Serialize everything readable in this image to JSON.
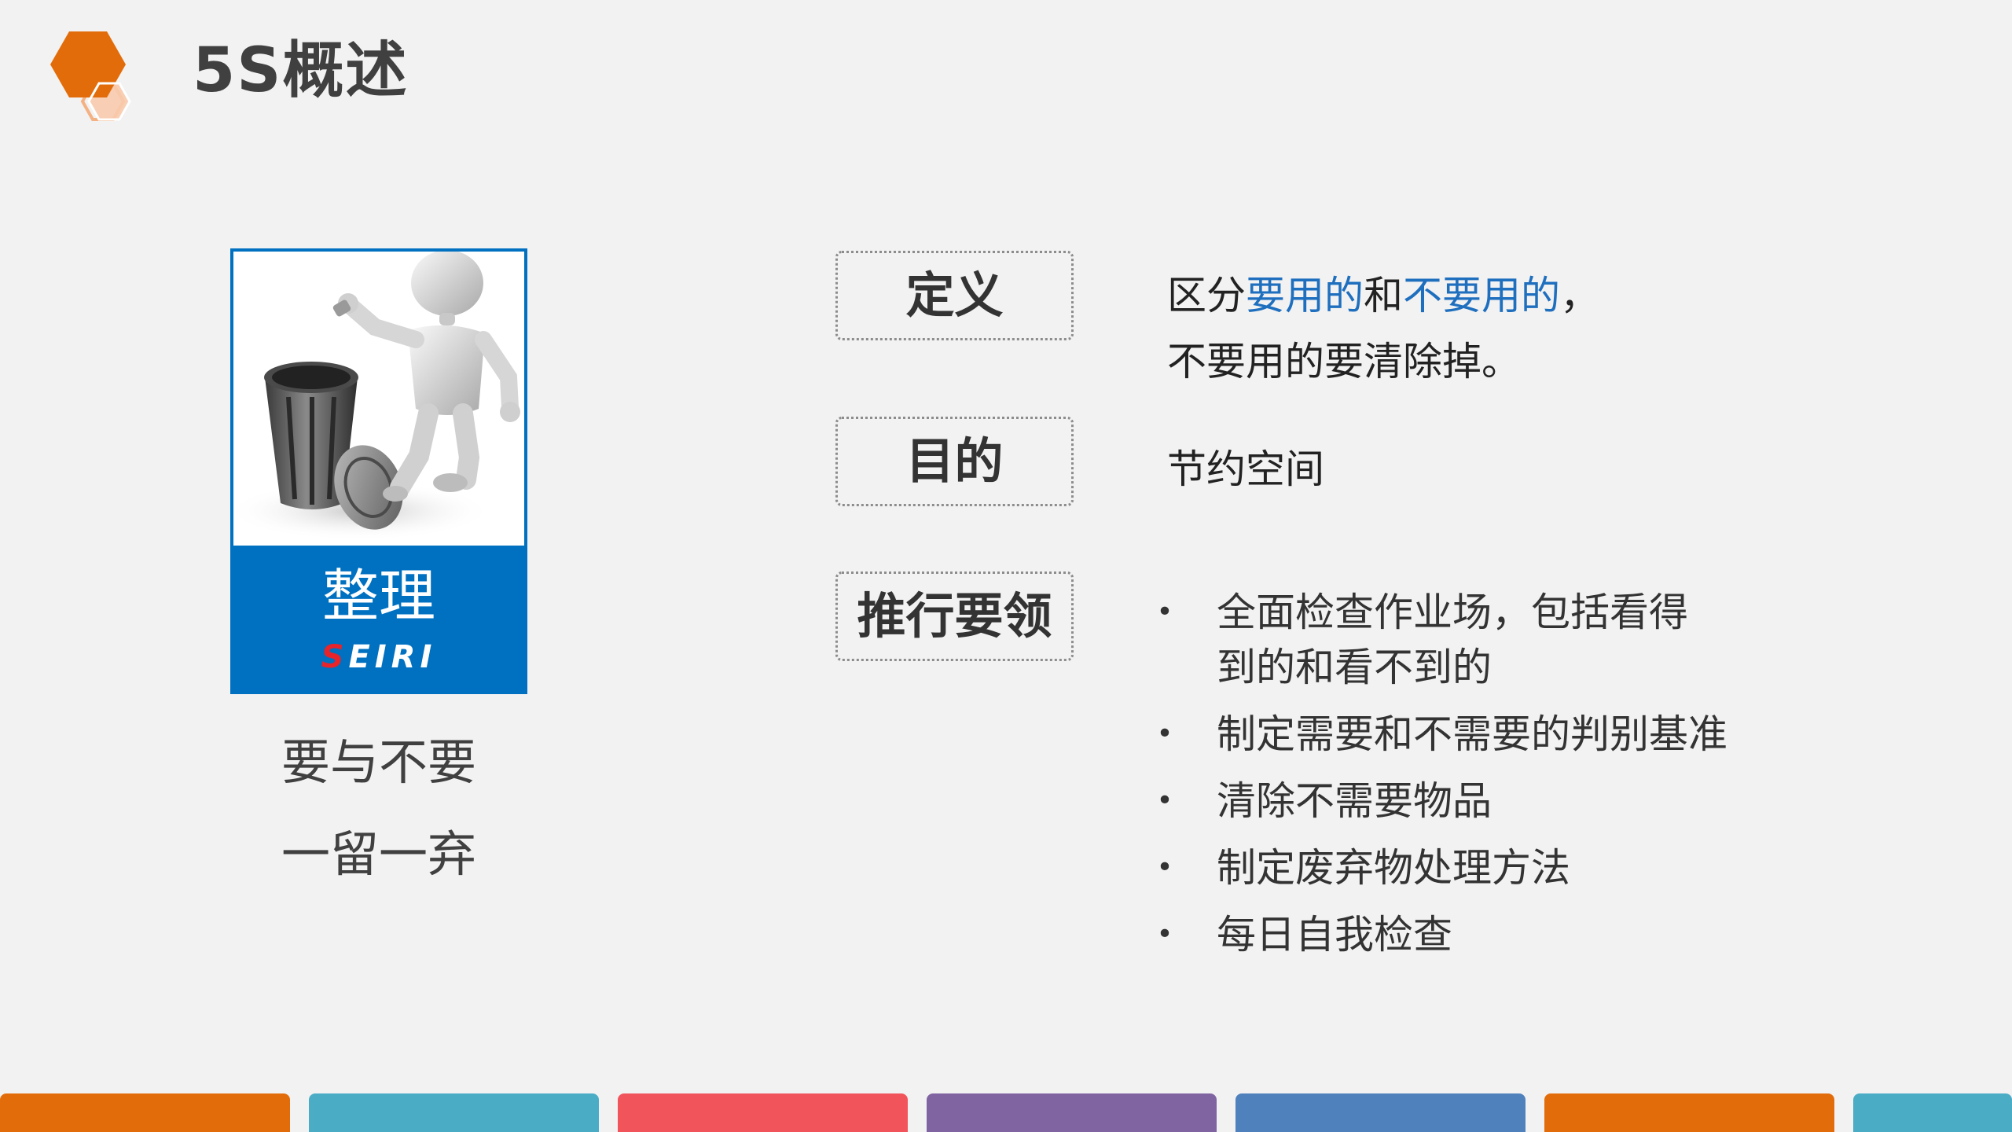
{
  "header": {
    "title": "5S概述",
    "logo_icon": "hexagon-logo-icon",
    "logo_colors": [
      "#e36c0a",
      "#f4b183"
    ]
  },
  "card": {
    "image_icon": "robot-with-trash-can-illustration",
    "label": "整理",
    "romaji_first": "S",
    "romaji_rest": "EIRI",
    "accent_color": "#0070c0"
  },
  "slogans": [
    "要与不要",
    "一留一弃"
  ],
  "definition": {
    "label": "定义",
    "text_1": "区分",
    "highlight_1": "要用的",
    "text_2": "和",
    "highlight_2": "不要用的",
    "text_3": "，",
    "line_2": "不要用的要清除掉。",
    "highlight_color": "#1f6fbf"
  },
  "purpose": {
    "label": "目的",
    "text": "节约空间"
  },
  "key_points": {
    "label": "推行要领",
    "items": [
      "全面检查作业场，包括看得到的和看不到的",
      "制定需要和不需要的判别基准",
      "清除不需要物品",
      "制定废弃物处理方法",
      "每日自我检查"
    ]
  },
  "bottom_bar_colors": [
    "#e36c0a",
    "#4bacc6",
    "#f2545b",
    "#8064a2",
    "#4f81bd",
    "#e36c0a",
    "#4bacc6"
  ]
}
